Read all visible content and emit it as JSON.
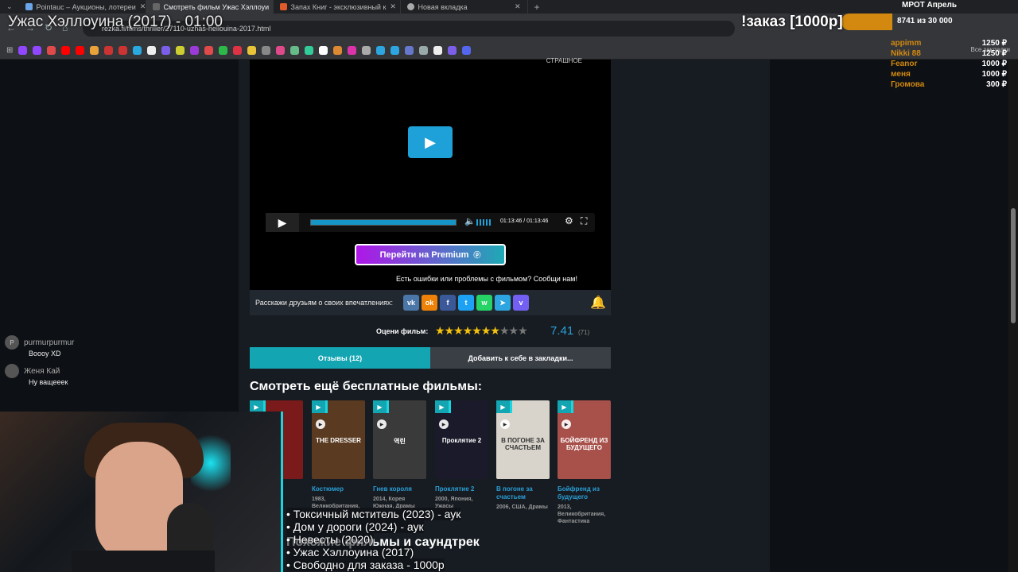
{
  "browser": {
    "tabs": [
      {
        "label": "Pointauc – Аукционы, лотереи",
        "active": false
      },
      {
        "label": "Смотреть фильм Ужас Хэллоуи",
        "active": true
      },
      {
        "label": "Запах Книг - эксклюзивный к",
        "active": false
      },
      {
        "label": "Новая вкладка",
        "active": false
      }
    ],
    "url": "rezka.fi/films/thriller/27110-uzhas-hellouina-2017.html",
    "all_bookmarks": "Все закладки"
  },
  "overlay": {
    "title": "Ужас Хэллоуина (2017) - 01:00",
    "goal_label": "!заказ [1000р]",
    "goal_text": "8741  из 30 000",
    "goal_fraction": 0.29,
    "mrot": "МРОТ Апрель",
    "donors": [
      {
        "name": "appimm",
        "amount": "1250 ₽"
      },
      {
        "name": "Nikki 88",
        "amount": "1250 ₽"
      },
      {
        "name": "Feanor",
        "amount": "1000 ₽"
      },
      {
        "name": "меня",
        "amount": "1000 ₽"
      },
      {
        "name": "Громова",
        "amount": "300 ₽"
      }
    ],
    "chat": [
      {
        "avatar": "P",
        "user": "purmurpurmur",
        "text": "Boooy XD"
      },
      {
        "avatar": "",
        "user": "Женя Кай",
        "text": "Ну ващееек"
      }
    ],
    "queue": [
      "• Токсичный мститель (2023) - аук",
      "• Дом у дороги (2024) - аук",
      "• Невесты (2020)",
      "• Ужас Хэллоуина (2017)",
      "• Свободно для заказа - 1000р"
    ]
  },
  "player": {
    "watermark": "СТРАШНОЕ",
    "time": "01:13:46 / 01:13:46",
    "premium_label": "Перейти на Premium",
    "report_text": "Есть ошибки или проблемы с фильмом? Сообщи нам!"
  },
  "share": {
    "label": "Расскажи друзьям о своих впечатлениях:",
    "icons": [
      {
        "name": "vk-icon",
        "glyph": "vk",
        "color": "#4a76a8"
      },
      {
        "name": "ok-icon",
        "glyph": "ok",
        "color": "#ee8208"
      },
      {
        "name": "facebook-icon",
        "glyph": "f",
        "color": "#3b5998"
      },
      {
        "name": "twitter-icon",
        "glyph": "t",
        "color": "#1da1f2"
      },
      {
        "name": "whatsapp-icon",
        "glyph": "w",
        "color": "#25d366"
      },
      {
        "name": "telegram-icon",
        "glyph": "➤",
        "color": "#2ca5e0"
      },
      {
        "name": "viber-icon",
        "glyph": "v",
        "color": "#7360f2"
      }
    ]
  },
  "rating": {
    "label": "Оцени фильм:",
    "score": "7.41",
    "votes": "(71)",
    "stars_filled": 7.41
  },
  "tabs": {
    "reviews": "Отзывы (12)",
    "bookmark": "Добавить к себе в закладки..."
  },
  "more": {
    "title": "Смотреть ещё бесплатные фильмы:",
    "movies": [
      {
        "title": "",
        "meta": "",
        "poster_text": "",
        "color": "#7a1a1a"
      },
      {
        "title": "Костюмер",
        "meta": "1983, Великобритания,",
        "poster_text": "THE DRESSER",
        "color": "#5a3a20"
      },
      {
        "title": "Гнев короля",
        "meta": "2014, Корея Южная, Драмы",
        "poster_text": "역린",
        "color": "#3a3a3a"
      },
      {
        "title": "Проклятие 2",
        "meta": "2000, Япония, Ужасы",
        "poster_text": "Проклятие 2",
        "color": "#1a1a2a"
      },
      {
        "title": "В погоне за счастьем",
        "meta": "2006, США, Драмы",
        "poster_text": "В ПОГОНЕ ЗА СЧАСТЬЕМ",
        "color": "#d8d4cc"
      },
      {
        "title": "Бойфренд из будущего",
        "meta": "2013, Великобритания, Фантастика",
        "poster_text": "БОЙФРЕНД ИЗ БУДУЩЕГО",
        "color": "#a8504a"
      }
    ],
    "similar_title": "Похожие фильмы и саундтрек"
  }
}
